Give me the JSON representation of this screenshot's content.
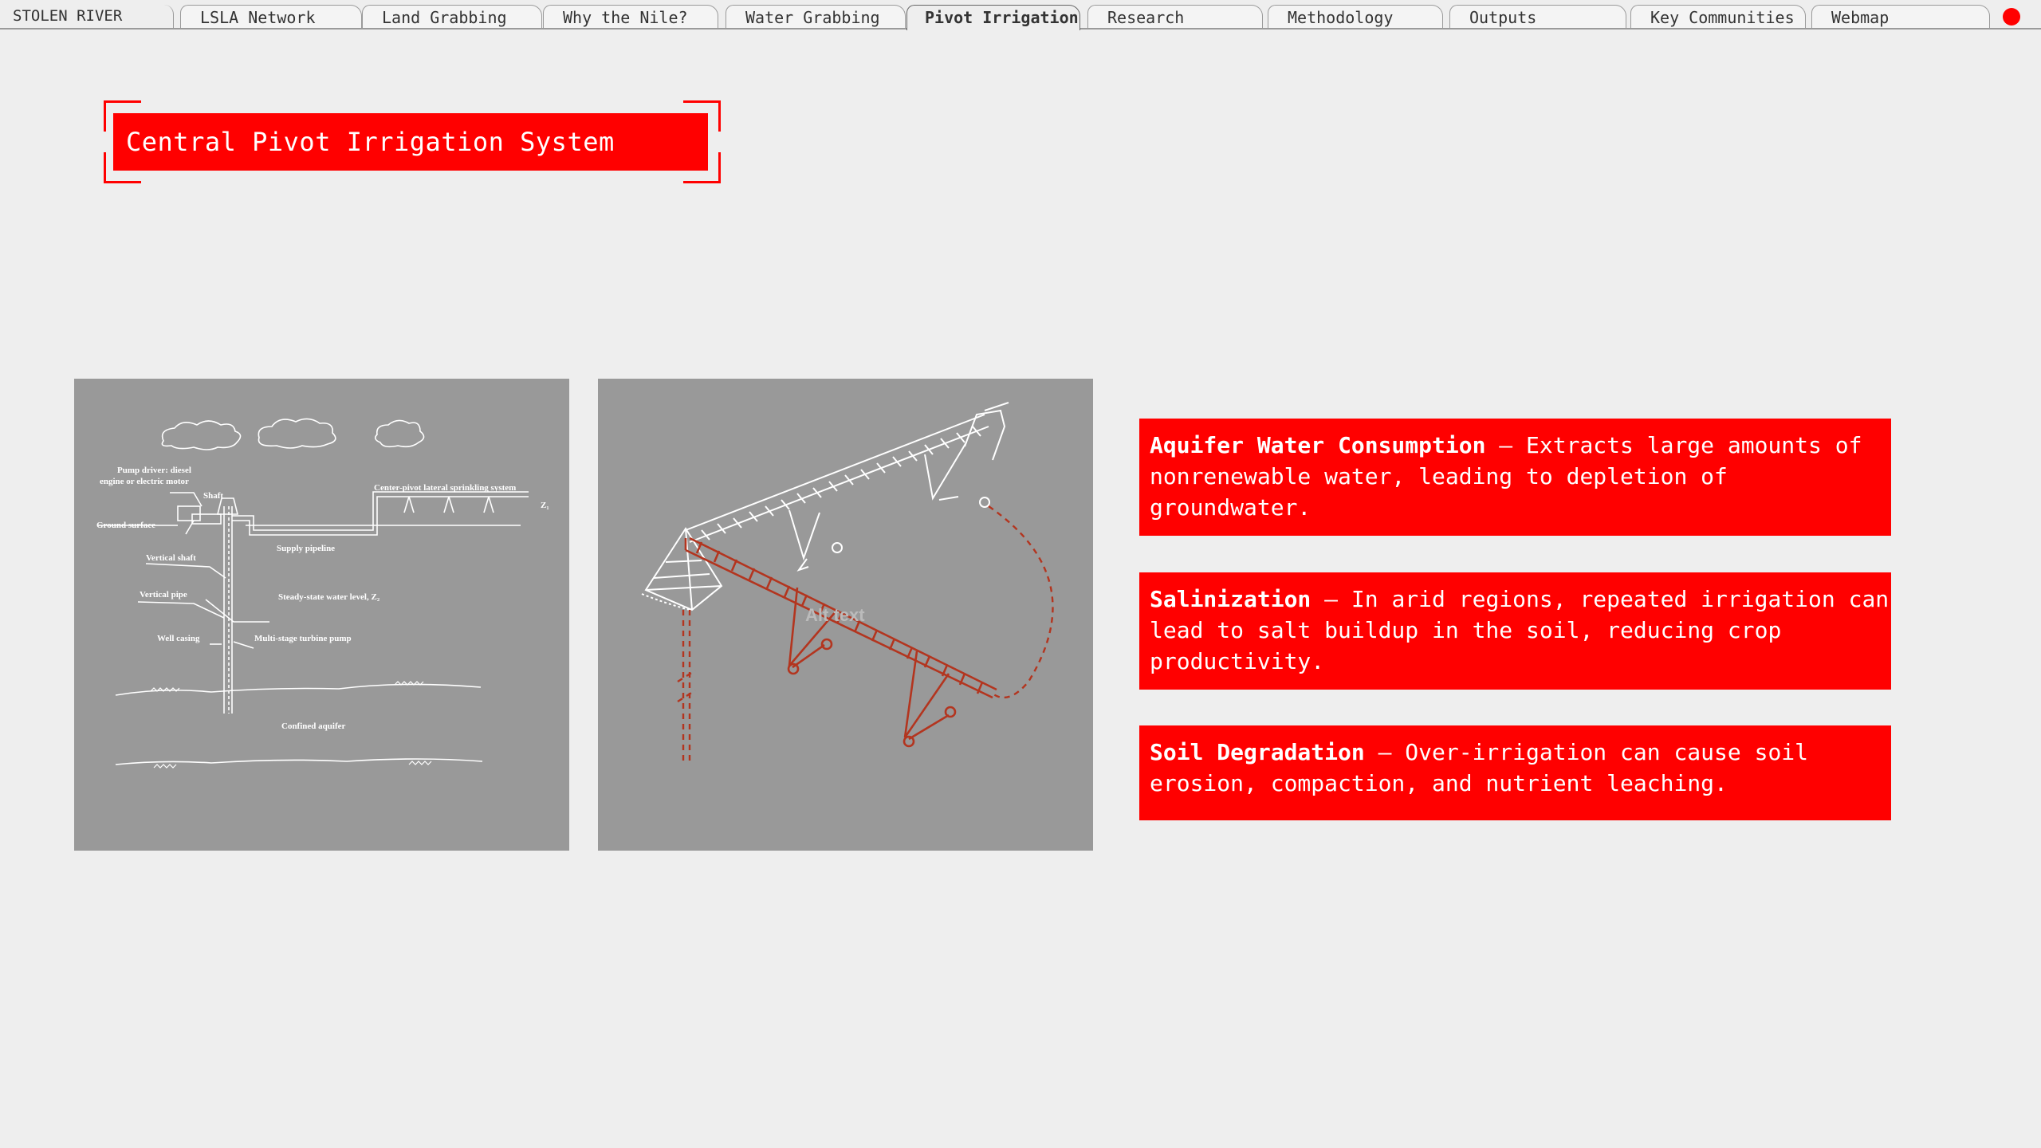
{
  "brand": "STOLEN RIVER",
  "tabs": [
    {
      "label": "LSLA Network"
    },
    {
      "label": "Land Grabbing"
    },
    {
      "label": "Why the Nile?"
    },
    {
      "label": "Water Grabbing"
    },
    {
      "label": "Pivot Irrigation",
      "active": true
    },
    {
      "label": "Research"
    },
    {
      "label": "Methodology"
    },
    {
      "label": "Outputs"
    },
    {
      "label": "Key Communities"
    },
    {
      "label": "Webmap"
    }
  ],
  "page_title": "Central Pivot Irrigation System",
  "diagram_left": {
    "labels": {
      "pump_driver_1": "Pump driver: diesel",
      "pump_driver_2": "engine or electric motor",
      "shaft": "Shaft",
      "ground_surface": "Ground surface",
      "center_pivot": "Center-pivot lateral sprinkling system",
      "z1": "Z₁",
      "supply_pipeline": "Supply pipeline",
      "vertical_shaft": "Vertical shaft",
      "vertical_pipe": "Vertical pipe",
      "steady_state": "Steady-state water level, Z₂",
      "well_casing": "Well casing",
      "turbine_pump": "Multi-stage turbine pump",
      "confined_aquifer": "Confined aquifer"
    }
  },
  "diagram_right": {
    "alt_text": "Alt text"
  },
  "cards": [
    {
      "title": "Aquifer Water Consumption",
      "body": " — Extracts large amounts of nonrenewable water, leading to depletion of groundwater."
    },
    {
      "title": "Salinization",
      "body": " — In arid regions, repeated irrigation can lead to salt buildup in the soil, reducing crop productivity."
    },
    {
      "title": "Soil Degradation",
      "body": " — Over-irrigation can cause soil erosion, compaction, and nutrient leaching."
    }
  ],
  "colors": {
    "accent": "#ff0000",
    "panel": "#999999",
    "background": "#eeeeee",
    "rust": "#b3351f"
  }
}
